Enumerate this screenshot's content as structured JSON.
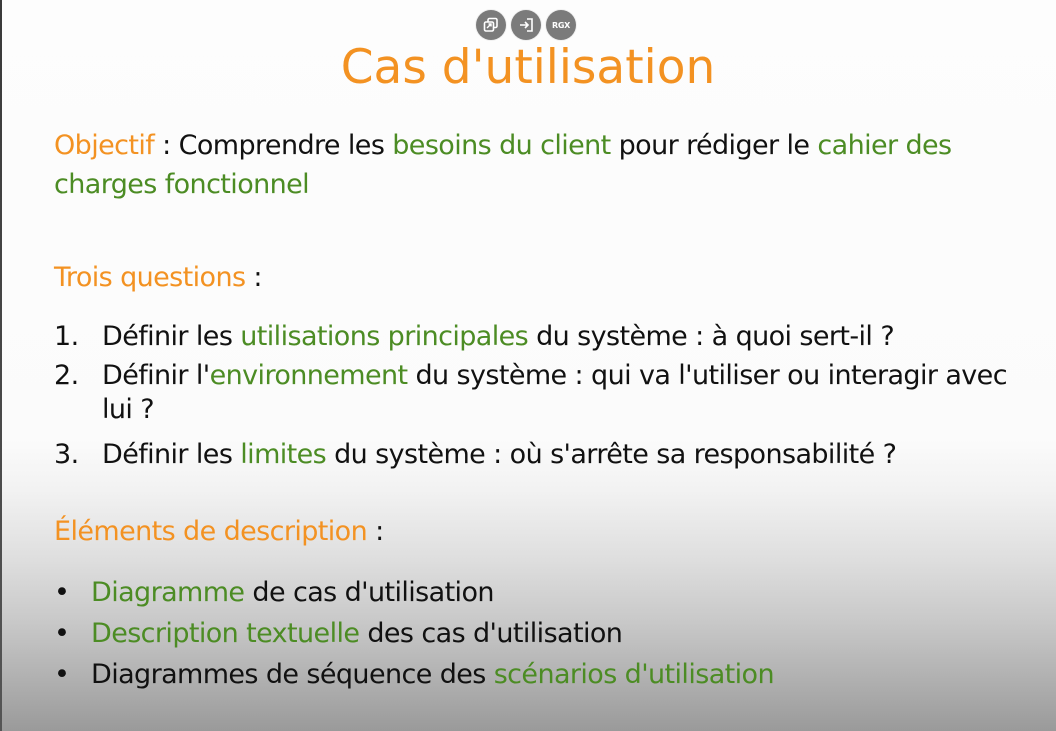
{
  "toolbar": {
    "buttons": [
      {
        "icon": "copy-icon"
      },
      {
        "icon": "exit-icon"
      },
      {
        "icon": "rgx-icon",
        "label": "RGX"
      }
    ]
  },
  "slide": {
    "title": "Cas d'utilisation",
    "objective": {
      "label": "Objectif",
      "sep": " : Comprendre les ",
      "needs": "besoins du client",
      "mid": " pour rédiger le ",
      "spec": "cahier des charges fonctionnel"
    },
    "questions_heading": {
      "label": "Trois questions",
      "colon": " :"
    },
    "questions": [
      {
        "num": "1.",
        "before": "Définir les ",
        "key": "utilisations principales",
        "after": " du système : à quoi sert-il ?"
      },
      {
        "num": "2.",
        "before": "Définir l'",
        "key": "environnement",
        "after": " du système : qui va l'utiliser ou interagir avec lui ?"
      },
      {
        "num": "3.",
        "before": "Définir les ",
        "key": "limites",
        "after": " du système : où s'arrête sa responsabilité ?"
      }
    ],
    "elements_heading": {
      "label": "Éléments de description",
      "colon": " :"
    },
    "elements": [
      {
        "bullet": "•",
        "before": "",
        "key": "Diagramme",
        "after": " de cas d'utilisation"
      },
      {
        "bullet": "•",
        "before": "",
        "key": "Description textuelle",
        "after": " des cas d'utilisation"
      },
      {
        "bullet": "•",
        "before": "Diagrammes de séquence des ",
        "key": "scénarios d'utilisation",
        "after": ""
      }
    ]
  },
  "colors": {
    "accent_orange": "#f39222",
    "accent_green": "#4c8c24",
    "text": "#111111",
    "button_gray": "#7b7b7b"
  }
}
